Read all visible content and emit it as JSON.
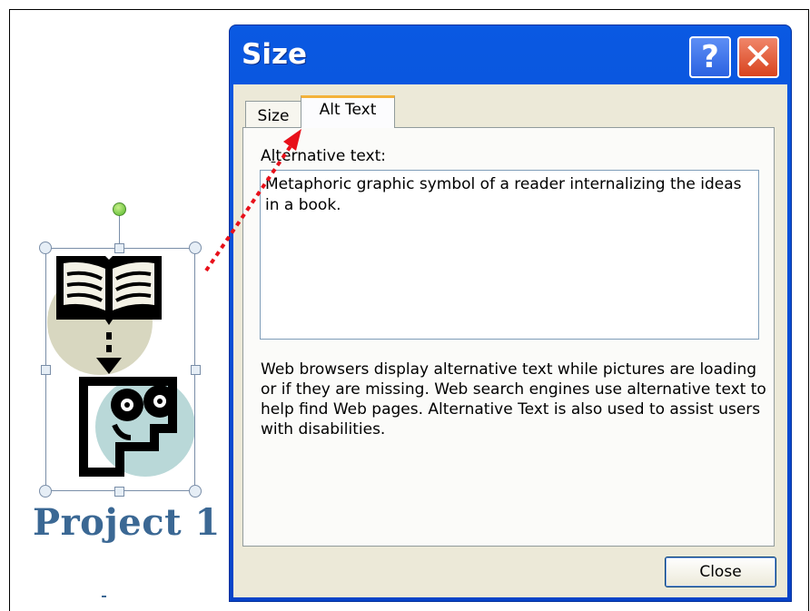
{
  "dialog": {
    "title": "Size",
    "help_button": "?",
    "close_glyph": "✕",
    "tabs": [
      {
        "label": "Size",
        "active": false
      },
      {
        "label": "Alt Text",
        "active": true
      }
    ],
    "alt_text_label_first": "A",
    "alt_text_label_underlined": "l",
    "alt_text_label_rest": "ternative text:",
    "alt_text_value": "Metaphoric graphic symbol of a reader internalizing the ideas in a book.",
    "help_text": "Web browsers display alternative text while pictures are loading or if they are missing.  Web search engines use alternative text to help find Web pages.  Alternative Text is also used to assist users with disabilities.",
    "close_button_label": "Close"
  },
  "canvas": {
    "project_title": "Project 1",
    "picture_icon": "book-reader-clipart-icon"
  },
  "colors": {
    "title_blue": "#0a59e2",
    "close_red": "#d8431e",
    "project_title": "#3b6894",
    "callout_arrow": "#e8101a"
  }
}
